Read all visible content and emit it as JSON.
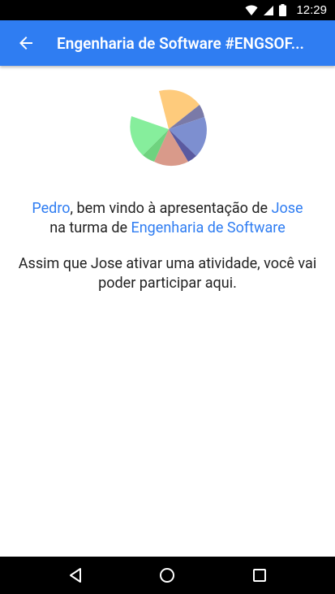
{
  "status_bar": {
    "time": "12:29",
    "icons": [
      "wifi-icon",
      "signal-icon",
      "battery-icon"
    ]
  },
  "app_bar": {
    "back_icon": "arrow-back-icon",
    "title": "Engenharia de Software #ENGSOF..."
  },
  "main": {
    "logo_icon": "pie-chart-logo",
    "welcome": {
      "user": "Pedro",
      "text1": ", bem vindo à apresentação de ",
      "presenter": "Jose",
      "text2": "na turma de ",
      "course": "Engenharia de Software"
    },
    "info": "Assim que Jose ativar uma atividade, você vai poder participar aqui."
  },
  "nav_bar": {
    "back": "nav-back-icon",
    "home": "nav-home-icon",
    "recents": "nav-recents-icon"
  },
  "colors": {
    "primary": "#2f7df2",
    "status_bar": "#000000",
    "text": "#222222"
  }
}
